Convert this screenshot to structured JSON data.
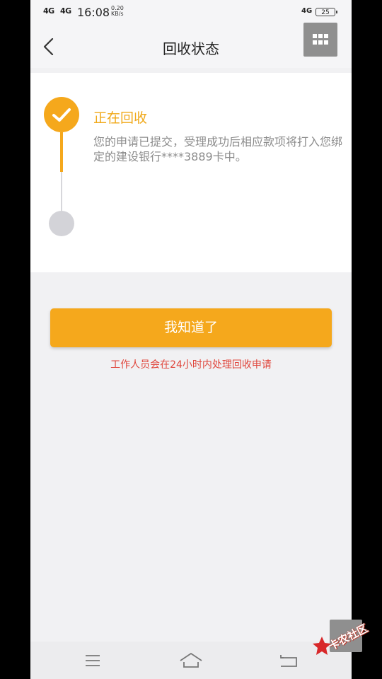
{
  "status_bar": {
    "signal_1": "4G",
    "signal_2": "4G",
    "time": "16:08",
    "speed_value": "0.20",
    "speed_unit": "KB/s",
    "network": "4G",
    "battery": "25"
  },
  "header": {
    "title": "回收状态"
  },
  "progress": {
    "step_title": "正在回收",
    "step_description": "您的申请已提交，受理成功后相应款项将打入您绑定的建设银行****3889卡中。"
  },
  "actions": {
    "confirm_label": "我知道了",
    "note": "工作人员会在24小时内处理回收申请"
  },
  "watermark": {
    "text": "卡农社区"
  },
  "colors": {
    "accent": "#f5a81c",
    "note_red": "#e0463c"
  }
}
